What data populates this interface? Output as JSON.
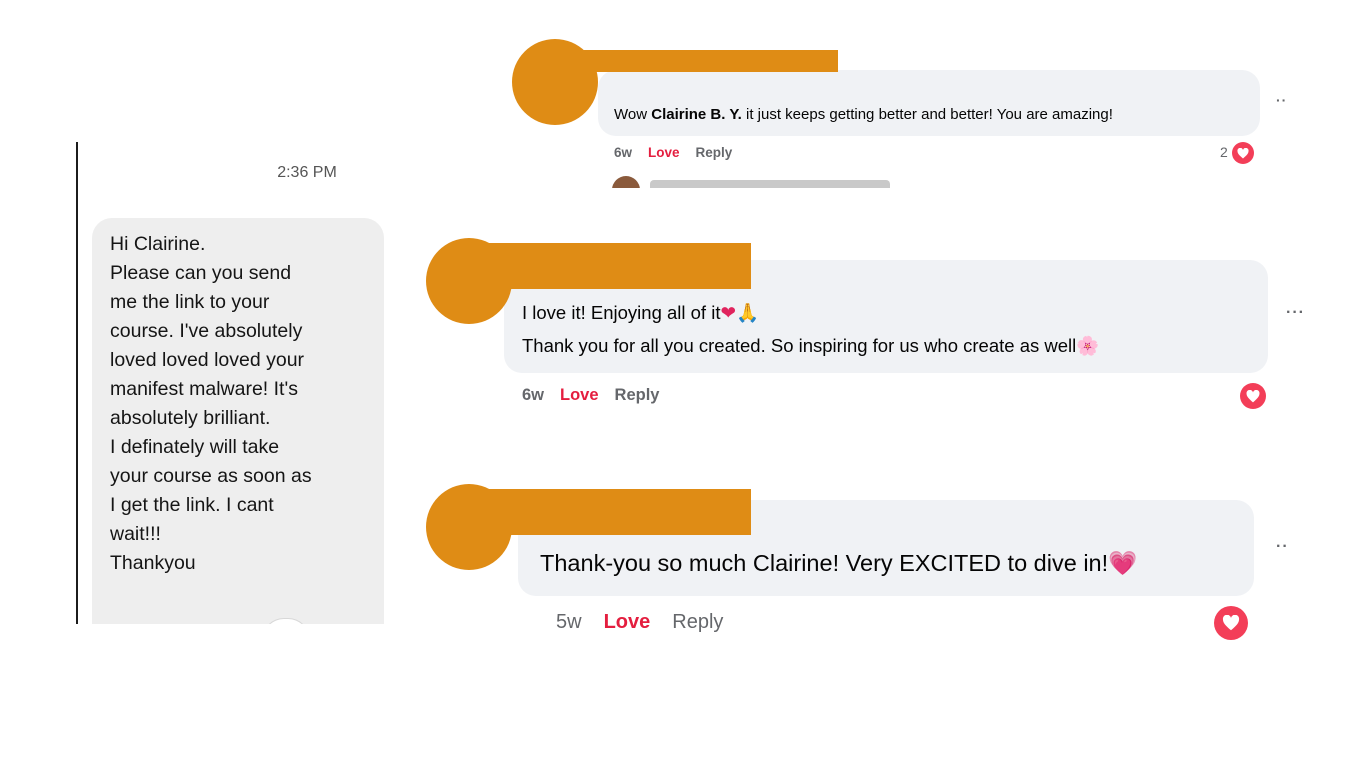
{
  "message_panel": {
    "time": "2:36 PM",
    "lines": [
      "Hi Clairine.",
      "Please can you send",
      "me the link to your",
      "course. I've absolutely",
      "loved loved loved your",
      "manifest malware! It's",
      "absolutely brilliant.",
      "I definately will take",
      "your course as soon as",
      "I get the link. I cant",
      "wait!!!",
      "Thankyou"
    ]
  },
  "comments": [
    {
      "text_before": "Wow ",
      "mention": "Clairine B. Y.",
      "text_after": " it just keeps getting better and better! You are amazing!",
      "age": "6w",
      "love": "Love",
      "reply": "Reply",
      "reaction_count": "2",
      "more": "··"
    },
    {
      "line1": "I love it! Enjoying all of it",
      "line1_emoji": "❤🙏",
      "line2": "Thank you for all you created. So inspiring for us who create as well",
      "line2_emoji": "🌸",
      "age": "6w",
      "love": "Love",
      "reply": "Reply",
      "more": "···"
    },
    {
      "text": "Thank-you so much Clairine! Very EXCITED to dive in!",
      "emoji": "💗",
      "age": "5w",
      "love": "Love",
      "reply": "Reply",
      "more": "··"
    }
  ],
  "colors": {
    "redaction": "#df8c15",
    "love": "#e41e3f",
    "heart": "#f33e58",
    "bubble": "#f0f2f5"
  }
}
